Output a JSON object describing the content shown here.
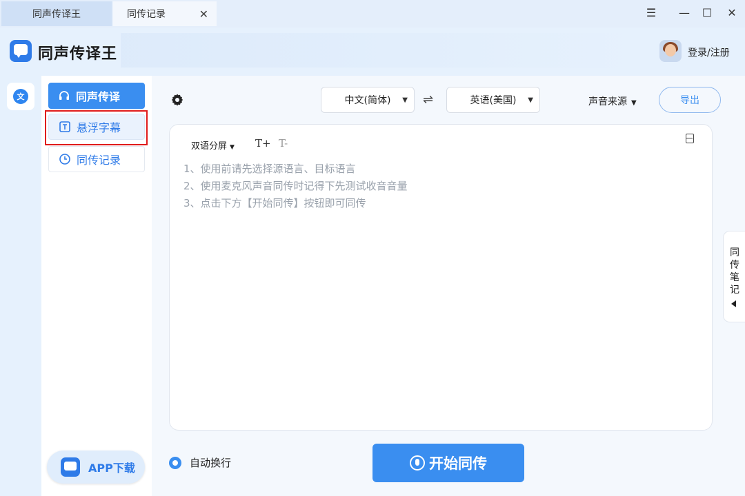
{
  "titlebar": {
    "tabs": [
      {
        "label": "同声传译王"
      },
      {
        "label": "同传记录"
      }
    ],
    "tab_close": "✕",
    "menu_glyph": "☰",
    "minimize_glyph": "—",
    "maximize_glyph": "☐",
    "close_glyph": "✕"
  },
  "header": {
    "brand": "同声传译王",
    "login": "登录/注册"
  },
  "rail": {
    "translate_glyph": "文"
  },
  "nav": {
    "items": [
      {
        "label": "同声传译",
        "icon": "headphones-icon"
      },
      {
        "label": "悬浮字幕",
        "icon": "text-box-icon"
      },
      {
        "label": "同传记录",
        "icon": "clock-icon"
      }
    ],
    "app_download": "APP下载"
  },
  "toolbar": {
    "source_lang": "中文(简体)",
    "target_lang": "英语(美国)",
    "swap_glyph": "⇌",
    "caret": "▼",
    "audio_source": "声音来源",
    "export": "导出"
  },
  "editor": {
    "view_mode": "双语分屏",
    "font_increase": "T+",
    "font_decrease": "T-",
    "hints": [
      "1、使用前请先选择源语言、目标语言",
      "2、使用麦克风声音同传时记得下先测试收音音量",
      "3、点击下方【开始同传】按钮即可同传"
    ]
  },
  "footer": {
    "auto_wrap": "自动换行",
    "start": "开始同传"
  },
  "notes_tab": {
    "label": "同传笔记"
  },
  "colors": {
    "accent": "#3a8ef0",
    "highlight": "#e01b1b",
    "background": "#e6f1fd"
  }
}
